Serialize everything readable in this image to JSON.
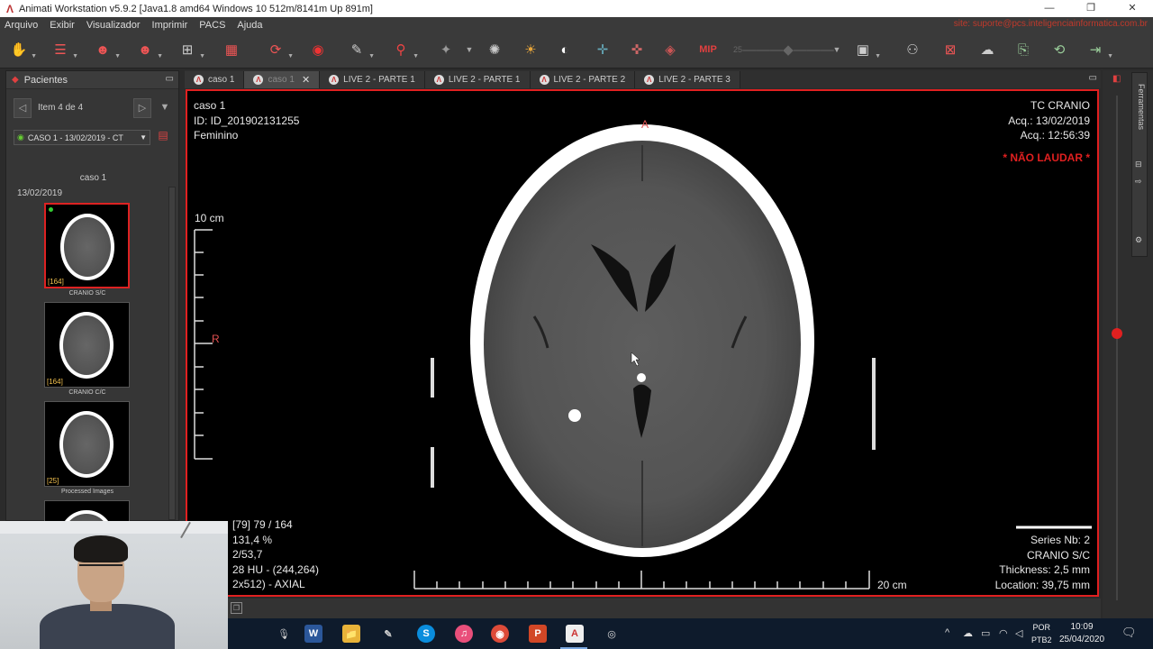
{
  "window": {
    "title": "Animati Workstation v5.9.2 [Java1.8 amd64 Windows 10 512m/8141m Up 891m]",
    "controls": [
      "—",
      "❐",
      "✕"
    ]
  },
  "menu": {
    "items": [
      "Arquivo",
      "Exibir",
      "Visualizador",
      "Imprimir",
      "PACS",
      "Ajuda"
    ],
    "link": "site: suporte@pcs.inteligenciainformatica.com.br"
  },
  "toolbar": {
    "mip_label": "MIP",
    "icons": [
      "hand-icon",
      "user-list-icon",
      "user-add-icon",
      "user-search-icon",
      "grid-icon",
      "layout-icon",
      "rotate-icon",
      "target-icon",
      "ruler-icon",
      "magnifier-icon",
      "pointer-icon",
      "brightness-icon",
      "sun-icon",
      "contrast-icon",
      "crosshair-icon",
      "3d-icon",
      "cube-icon",
      "mip-icon",
      "slider-icon",
      "monitor-icon",
      "people-icon",
      "grid-settings-icon",
      "cloud-icon",
      "export-icon",
      "refresh-icon",
      "exit-icon"
    ]
  },
  "patients_panel": {
    "title": "Pacientes",
    "item_counter": "Item 4 de 4",
    "case_selector": "CASO 1 - 13/02/2019 - CT",
    "case_name": "caso 1",
    "date": "13/02/2019",
    "thumbnails": [
      {
        "count": "[164]",
        "label": "CRANIO S/C",
        "selected": true
      },
      {
        "count": "[164]",
        "label": "CRANIO C/C",
        "selected": false
      },
      {
        "count": "[25]",
        "label": "Processed Images",
        "selected": false
      }
    ]
  },
  "tabs": [
    {
      "label": "caso 1",
      "active": false
    },
    {
      "label": "caso 1",
      "active": true
    },
    {
      "label": "LIVE 2 - PARTE 1",
      "active": false
    },
    {
      "label": "LIVE 2 - PARTE 1",
      "active": false
    },
    {
      "label": "LIVE 2 - PARTE 2",
      "active": false
    },
    {
      "label": "LIVE 2 - PARTE 3",
      "active": false
    }
  ],
  "viewer": {
    "top_left": [
      "caso 1",
      "ID: ID_201902131255",
      "Feminino"
    ],
    "top_right": [
      "TC CRANIO",
      "Acq.: 13/02/2019",
      "Acq.: 12:56:39"
    ],
    "warning": "* NÃO LAUDAR *",
    "orientation_top": "A",
    "orientation_left": "R",
    "scale_vertical": "10 cm",
    "scale_horizontal": "20 cm",
    "bottom_left": [
      "[79] 79 / 164",
      "131,4 %",
      "2/53,7",
      "28 HU - (244,264)",
      "2x512) - AXIAL"
    ],
    "bottom_right": [
      "Series Nb: 2",
      "CRANIO S/C",
      "Thickness: 2,5 mm",
      "Location: 39,75 mm"
    ]
  },
  "right_panel": {
    "label": "Ferramentas"
  },
  "taskbar": {
    "apps": [
      "W",
      "📁",
      "✎",
      "S",
      "♫",
      "◉",
      "P",
      "A",
      "◎"
    ],
    "lang_top": "POR",
    "lang_bottom": "PTB2",
    "time": "10:09",
    "date": "25/04/2020"
  }
}
